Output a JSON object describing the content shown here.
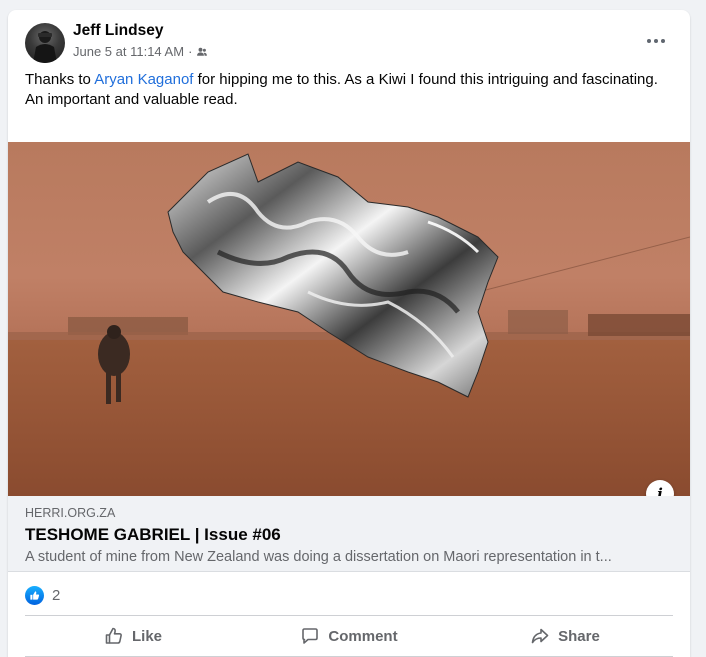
{
  "post": {
    "author": "Jeff Lindsey",
    "timestamp": "June 5 at 11:14 AM",
    "separator": "·",
    "audience_icon": "friends-icon",
    "more_icon": "more-horizontal-icon",
    "text": {
      "prefix": "Thanks to ",
      "mention": "Aryan Kaganof",
      "suffix": " for hipping me to this. As a Kiwi I found this intriguing and fascinating.",
      "line2": "An important and valuable read."
    }
  },
  "link_preview": {
    "domain": "HERRI.ORG.ZA",
    "title": "TESHOME GABRIEL | Issue #06",
    "description": "A student of mine from New Zealand was doing a dissertation on Maori representation in t..."
  },
  "media": {
    "info_icon": "info-icon",
    "info_label": "i"
  },
  "reactions": {
    "icon": "like-reaction-icon",
    "count": "2"
  },
  "actions": {
    "like": "Like",
    "comment": "Comment",
    "share": "Share"
  },
  "colors": {
    "link": "#216fdb",
    "secondary_text": "#65676b",
    "like_blue": "#0062df"
  }
}
